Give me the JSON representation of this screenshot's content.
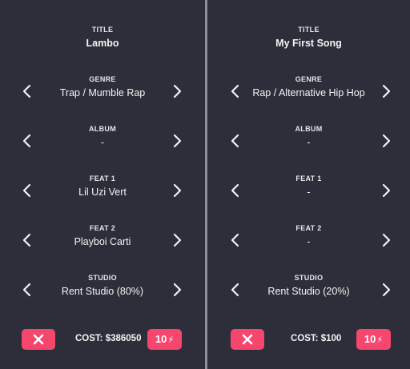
{
  "colors": {
    "background": "#2c2d38",
    "accent": "#f5476e",
    "divider": "#8d8e95",
    "text": "#f2f2f2"
  },
  "songs": [
    {
      "title_label": "TITLE",
      "title": "Lambo",
      "genre_label": "GENRE",
      "genre": "Trap / Mumble Rap",
      "album_label": "ALBUM",
      "album": "-",
      "feat1_label": "FEAT 1",
      "feat1": "Lil Uzi Vert",
      "feat2_label": "FEAT 2",
      "feat2": "Playboi Carti",
      "studio_label": "STUDIO",
      "studio": "Rent Studio (80%)",
      "cost": "COST: $386050",
      "energy": "10",
      "energy_icon": "⚡"
    },
    {
      "title_label": "TITLE",
      "title": "My First Song",
      "genre_label": "GENRE",
      "genre": "Rap / Alternative Hip Hop",
      "album_label": "ALBUM",
      "album": "-",
      "feat1_label": "FEAT 1",
      "feat1": "-",
      "feat2_label": "FEAT 2",
      "feat2": "-",
      "studio_label": "STUDIO",
      "studio": "Rent Studio (20%)",
      "cost": "COST: $100",
      "energy": "10",
      "energy_icon": "⚡"
    }
  ],
  "icons": {
    "prev": "chevron-left-icon",
    "next": "chevron-right-icon",
    "cancel": "close-icon",
    "energy": "lightning-icon"
  }
}
